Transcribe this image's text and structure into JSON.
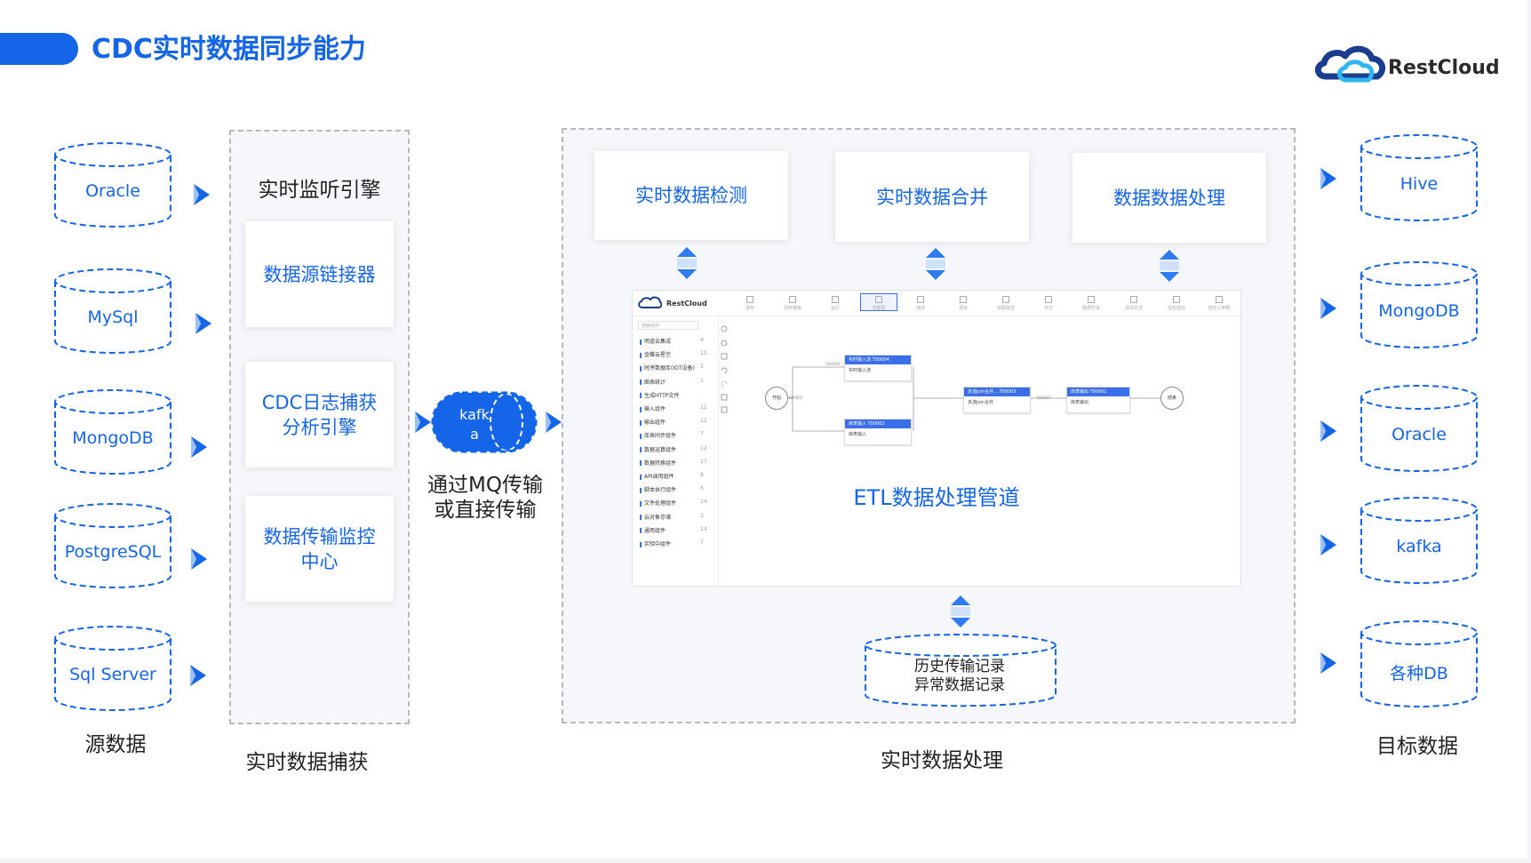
{
  "title": "CDC实时数据同步能力",
  "logo": {
    "text": "RestCloud",
    "icon": "cloud-logo-icon"
  },
  "colors": {
    "accent": "#1565e8",
    "arrow": "#1565e8"
  },
  "sources": {
    "items": [
      "Oracle",
      "MySql",
      "MongoDB",
      "PostgreSQL",
      "Sql Server"
    ],
    "caption": "源数据"
  },
  "capture": {
    "heading": "实时监听引擎",
    "cards": [
      "数据源链接器",
      "CDC日志捕获\n分析引擎",
      "数据传输监控\n中心"
    ],
    "caption": "实时数据捕获"
  },
  "mq": {
    "label": "kafk\na",
    "text": "通过MQ传输\n或直接传输"
  },
  "processing": {
    "cards": [
      "实时数据检测",
      "实时数据合并",
      "数据数据处理"
    ],
    "etl_label": "ETL数据处理管道",
    "history": "历史传输记录\n异常数据记录",
    "caption": "实时数据处理",
    "screenshot": {
      "brand": "RestCloud",
      "toolbar": [
        "保存",
        "另存模板",
        "运行",
        "流程图",
        "连线",
        "调度",
        "流程属性",
        "日志",
        "数据开发",
        "调试日志",
        "任务监控",
        "自定义参数"
      ],
      "search_placeholder": "搜索组件",
      "side_items": [
        "明道云集成",
        "金蝶云星空",
        "时序数据库(IOT设备)",
        "图表统计",
        "生成HTTP文件",
        "输入组件",
        "输出组件",
        "库表同步组件",
        "数据运算组件",
        "数据转换组件",
        "API调用组件",
        "脚本执行组件",
        "文件处理组件",
        "云对象存储",
        "通用组件",
        "实验中组件"
      ],
      "side_counts": [
        "4",
        "11",
        "2",
        "1",
        "",
        "11",
        "12",
        "7",
        "12",
        "17",
        "8",
        "6",
        "14",
        "3",
        "14",
        "7"
      ],
      "nodes": [
        {
          "head": "实时输入流  T00004",
          "body": "实时输入流"
        },
        {
          "head": "库表输入     T00002",
          "body": "库表输入"
        },
        {
          "head": "多流join合并...  T00003",
          "body": "多流join合并"
        },
        {
          "head": "库表输出     T00001",
          "body": "库表输出"
        }
      ],
      "start": "开始",
      "end": "结束",
      "edge_labels": [
        "R00005",
        "R00003",
        "R00007"
      ]
    }
  },
  "targets": {
    "items": [
      "Hive",
      "MongoDB",
      "Oracle",
      "kafka",
      "各种DB"
    ],
    "caption": "目标数据"
  }
}
